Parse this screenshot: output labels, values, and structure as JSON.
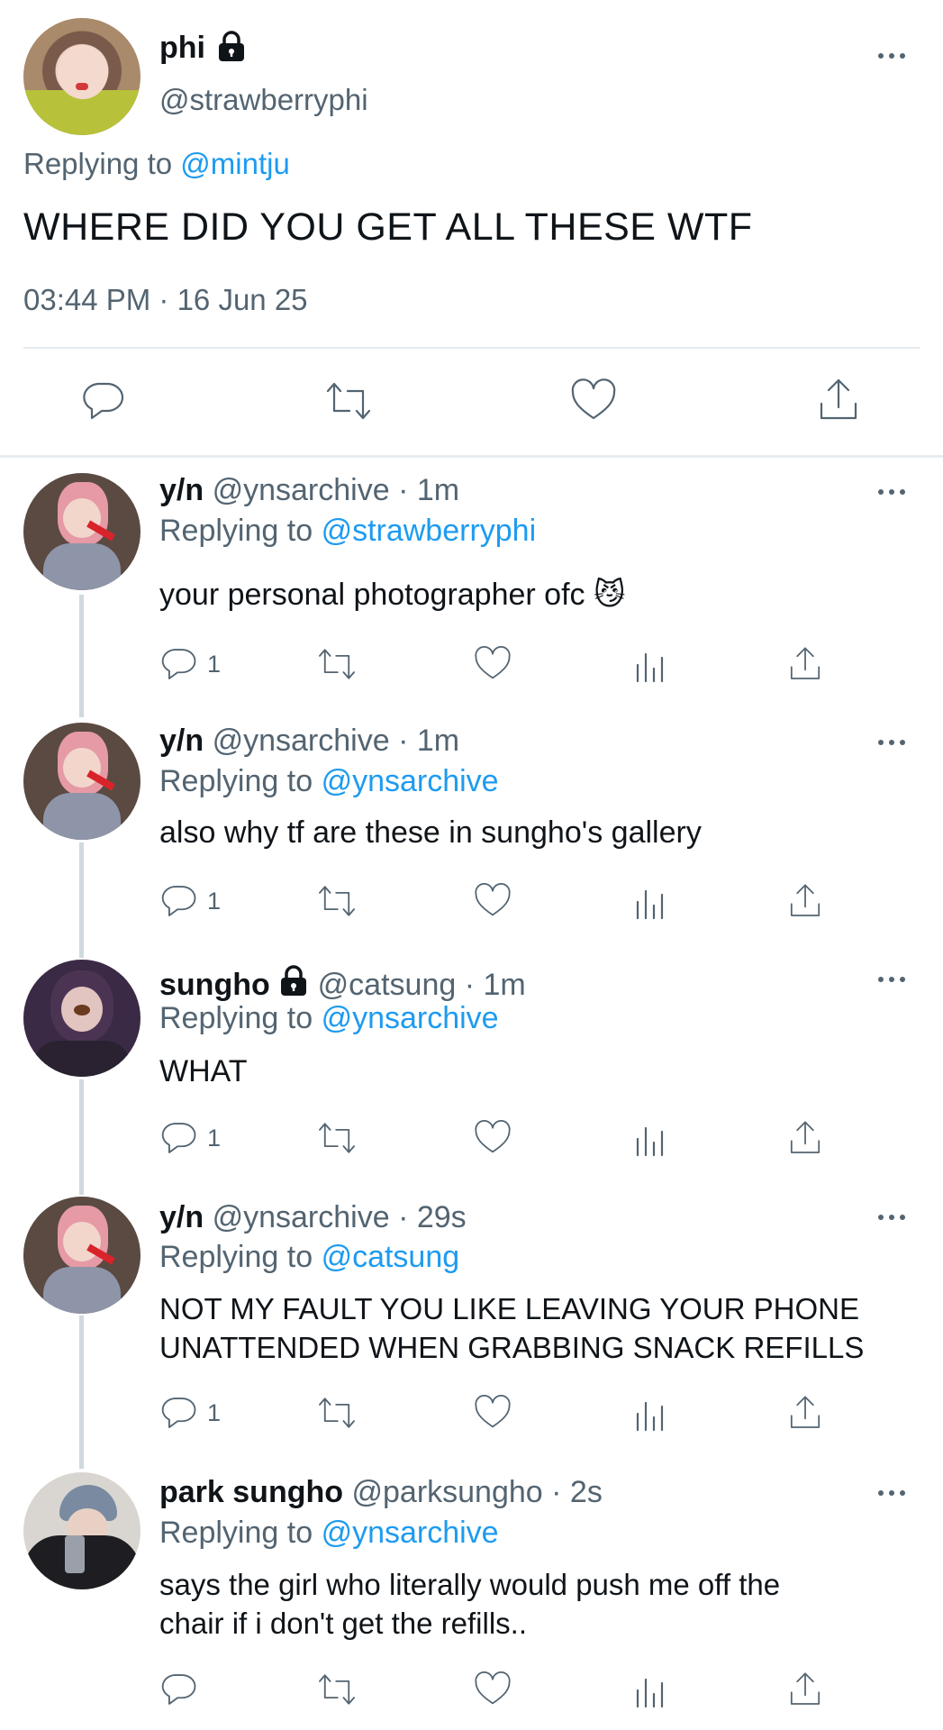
{
  "main_tweet": {
    "display_name": "phi",
    "handle": "@strawberryphi",
    "replying_label": "Replying to",
    "replying_to": "@mintju",
    "text": "WHERE DID YOU GET ALL THESE WTF",
    "timestamp": "03:44 PM · 16 Jun 25",
    "locked": true,
    "icons": [
      "speech-bubble-icon",
      "retweet-icon",
      "heart-icon",
      "share-icon"
    ]
  },
  "replies": [
    {
      "display_name": "y/n",
      "handle": "@ynsarchive",
      "time": "· 1m",
      "replying_label": "Replying to",
      "replying_to": "@strawberryphi",
      "text": "your personal photographer ofc 😼",
      "reply_count": "1",
      "locked": false
    },
    {
      "display_name": "y/n",
      "handle": "@ynsarchive",
      "time": "· 1m",
      "replying_label": "Replying to",
      "replying_to": "@ynsarchive",
      "text": "also why tf are these in sungho's gallery",
      "reply_count": "1",
      "locked": false
    },
    {
      "display_name": "sungho",
      "handle": "@catsung",
      "time": "· 1m",
      "replying_label": "Replying to",
      "replying_to": "@ynsarchive",
      "text": "WHAT",
      "reply_count": "1",
      "locked": true
    },
    {
      "display_name": "y/n",
      "handle": "@ynsarchive",
      "time": "· 29s",
      "replying_label": "Replying to",
      "replying_to": "@catsung",
      "text_line1": "NOT MY FAULT YOU LIKE LEAVING YOUR PHONE",
      "text_line2": "UNATTENDED WHEN GRABBING SNACK REFILLS",
      "reply_count": "1",
      "locked": false
    },
    {
      "display_name": "park sungho",
      "handle": "@parksungho",
      "time": "· 2s",
      "replying_label": "Replying to",
      "replying_to": "@ynsarchive",
      "text_line1": "says the girl who literally would push me off the",
      "text_line2": "chair if i don't get the refills..",
      "reply_count": "",
      "locked": false
    }
  ],
  "colors": {
    "link_blue": "#1d9bf0",
    "secondary_gray": "#536471",
    "divider": "#cfd9de"
  }
}
